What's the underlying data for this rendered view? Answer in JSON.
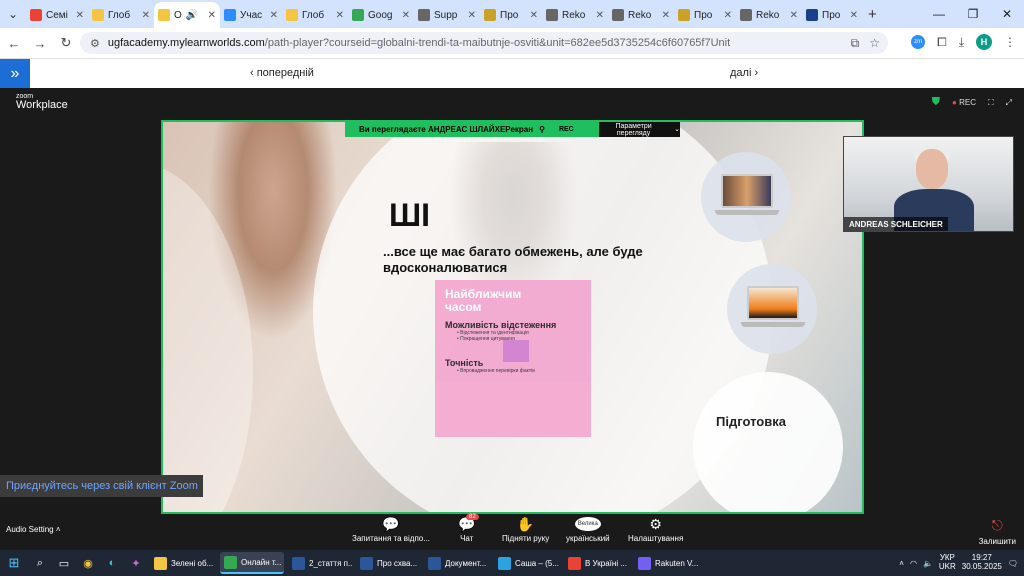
{
  "browser": {
    "tabs": [
      {
        "label": "Семі",
        "icon": "gmail-icon",
        "color": "#ea4335",
        "active": false
      },
      {
        "label": "Глоб",
        "icon": "folder-icon",
        "color": "#f4c542",
        "active": false
      },
      {
        "label": "О",
        "icon": "folder-icon",
        "color": "#f4c542",
        "active": true,
        "audio": "🔊"
      },
      {
        "label": "Учас",
        "icon": "zoom-icon",
        "color": "#2d8cff",
        "active": false
      },
      {
        "label": "Глоб",
        "icon": "folder-icon",
        "color": "#f4c542",
        "active": false
      },
      {
        "label": "Goog",
        "icon": "google-icon",
        "color": "#34a853",
        "active": false
      },
      {
        "label": "Supp",
        "icon": "globe-icon",
        "color": "#666666",
        "active": false
      },
      {
        "label": "Про",
        "icon": "shield-icon",
        "color": "#c9a227",
        "active": false
      },
      {
        "label": "Reko",
        "icon": "globe-icon",
        "color": "#666666",
        "active": false
      },
      {
        "label": "Reko",
        "icon": "globe-icon",
        "color": "#666666",
        "active": false
      },
      {
        "label": "Про",
        "icon": "shield-icon",
        "color": "#c9a227",
        "active": false
      },
      {
        "label": "Reko",
        "icon": "globe-icon",
        "color": "#666666",
        "active": false
      },
      {
        "label": "Про",
        "icon": "bookmark-icon",
        "color": "#1a3f8f",
        "active": false
      }
    ],
    "url_host": "ugfacademy.mylearnworlds.com",
    "url_rest": "/path-player?courseid=globalni-trendi-ta-maibutnje-osviti&unit=682ee5d3735254c6f60765f7Unit",
    "profile_initial": "H"
  },
  "lms_nav": {
    "prev_label": "‹ попередній",
    "next_label": "далі ›"
  },
  "zoom": {
    "logo_small": "zoom",
    "logo_big": "Workplace",
    "rec_label": "REC",
    "share_banner": "Ви переглядаєте АНДРЕАС ШЛАЙХЕРекран",
    "share_rec": "REC",
    "view_options": "Параметри перегляду",
    "speaker_name": "ANDREAS SCHLEICHER",
    "join_banner": "Приєднуйтесь через свій клієнт Zoom",
    "audio_setting": "Audio Setting",
    "toolbar": {
      "qa_label": "Запитання та відпо...",
      "chat_label": "Чат",
      "chat_badge": "82",
      "raise_hand_label": "Підняти руку",
      "lang_label": "український",
      "lang_bubble": "Велика",
      "settings_label": "Налаштування",
      "leave_label": "Залишити"
    }
  },
  "slide": {
    "title": "ШІ",
    "subtitle": "...все ще має багато обмежень, але буде вдосконалюватися",
    "card_heading": "Найближчим часом",
    "section1_title": "Можливість відстеження",
    "section1_items": [
      "Відстеження та ідентифікація",
      "Покращення цитування"
    ],
    "section2_title": "Точність",
    "section2_items": [
      "Впровадження перевірки фактів"
    ],
    "prep_label": "Підготовка"
  },
  "taskbar": {
    "apps": [
      {
        "label": "Зелені об...",
        "icon": "file-explorer-icon",
        "color": "#f4c542",
        "active": false
      },
      {
        "label": "Онлайн т...",
        "icon": "chrome-icon",
        "color": "#34a853",
        "active": true
      },
      {
        "label": "2_стаття п...",
        "icon": "word-icon",
        "color": "#2b579a",
        "active": false
      },
      {
        "label": "Про схва...",
        "icon": "word-icon",
        "color": "#2b579a",
        "active": false
      },
      {
        "label": "Документ...",
        "icon": "word-icon",
        "color": "#2b579a",
        "active": false
      },
      {
        "label": "Саша – (5...",
        "icon": "telegram-icon",
        "color": "#2aa3e0",
        "active": false
      },
      {
        "label": "В Україні ...",
        "icon": "chrome-icon",
        "color": "#ea4335",
        "active": false
      },
      {
        "label": "Rakuten V...",
        "icon": "viber-icon",
        "color": "#7360f2",
        "active": false
      }
    ],
    "lang_line1": "УКР",
    "lang_line2": "UKR",
    "time": "19:27",
    "date": "30.05.2025"
  }
}
